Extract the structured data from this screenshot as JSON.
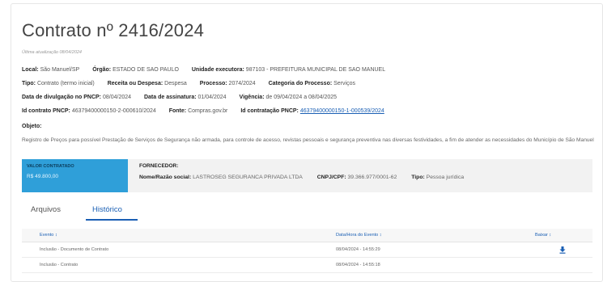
{
  "page": {
    "title": "Contrato nº 2416/2024",
    "updated": "Última atualização 08/04/2024"
  },
  "info": {
    "local_label": "Local:",
    "local_value": "São Manuel/SP",
    "orgao_label": "Órgão:",
    "orgao_value": "ESTADO DE SAO PAULO",
    "unidade_label": "Unidade executora:",
    "unidade_value": "987103 - PREFEITURA MUNICIPAL DE SAO MANUEL",
    "tipo_label": "Tipo:",
    "tipo_value": "Contrato (termo inicial)",
    "receita_label": "Receita ou Despesa:",
    "receita_value": "Despesa",
    "processo_label": "Processo:",
    "processo_value": "2074/2024",
    "categoria_label": "Categoria do Processo:",
    "categoria_value": "Serviços",
    "divulgacao_label": "Data de divulgação no PNCP:",
    "divulgacao_value": "08/04/2024",
    "assinatura_label": "Data de assinatura:",
    "assinatura_value": "01/04/2024",
    "vigencia_label": "Vigência:",
    "vigencia_value": "de 09/04/2024 a 08/04/2025",
    "idcontrato_label": "Id contrato PNCP:",
    "idcontrato_value": "46379400000150-2-000610/2024",
    "fonte_label": "Fonte:",
    "fonte_value": "Compras.gov.br",
    "idcontratacao_label": "Id contratação PNCP:",
    "idcontratacao_value": "46379400000150-1-000539/2024"
  },
  "objeto": {
    "label": "Objeto:",
    "text": "Registro de Preços para possível Prestação de Serviços de Segurança não armada, para controle de acesso, revistas pessoais e segurança preventiva nas diversas festividades, a fim de atender as necessidades do Município de São Manuel"
  },
  "valor": {
    "label": "VALOR CONTRATADO",
    "value": "R$ 49.800,00"
  },
  "fornecedor": {
    "label": "FORNECEDOR:",
    "nome_label": "Nome/Razão social:",
    "nome_value": "LASTROSEG SEGURANCA PRIVADA LTDA",
    "cnpj_label": "CNPJ/CPF:",
    "cnpj_value": "39.366.977/0001-62",
    "tipo_label": "Tipo:",
    "tipo_value": "Pessoa jurídica"
  },
  "tabs": [
    {
      "label": "Arquivos",
      "active": false
    },
    {
      "label": "Histórico",
      "active": true
    }
  ],
  "table": {
    "headers": [
      "Evento ↕",
      "Data/Hora do Evento ↕",
      "Baixar ↕"
    ],
    "rows": [
      {
        "evento": "Inclusão - Documento de Contrato",
        "data": "08/04/2024 - 14:55:29",
        "download": true
      },
      {
        "evento": "Inclusão - Contrato",
        "data": "08/04/2024 - 14:55:18",
        "download": false
      }
    ]
  },
  "colors": {
    "accent": "#1a5fb4",
    "valor_bg": "#2f9fd9",
    "fornecedor_bg": "#f2f2f2"
  },
  "icons": {
    "download": "download-icon"
  }
}
